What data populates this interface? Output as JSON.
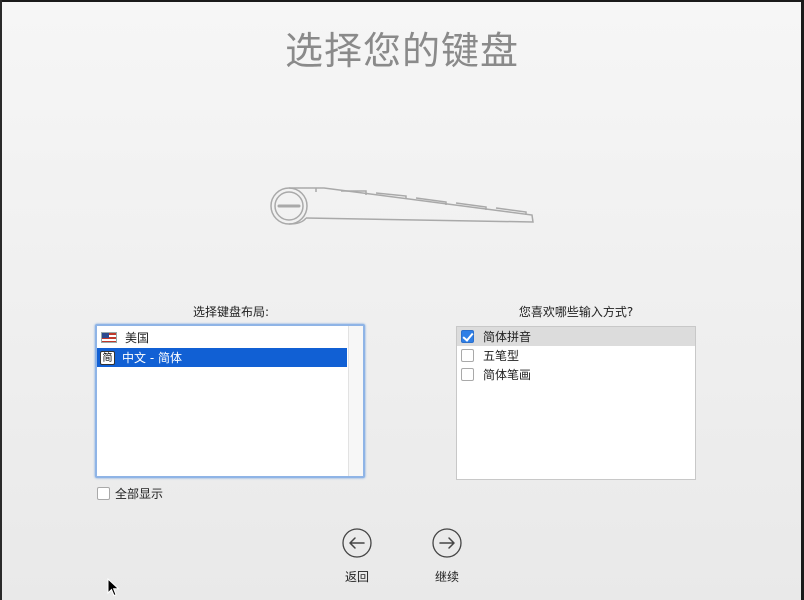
{
  "header": {
    "title": "选择您的键盘"
  },
  "layout_panel": {
    "label": "选择键盘布局:",
    "items": [
      {
        "label": "美国",
        "icon": "us-flag-icon",
        "selected": false
      },
      {
        "label": "中文 - 简体",
        "icon_text": "简",
        "selected": true
      }
    ],
    "show_all_label": "全部显示",
    "show_all_checked": false
  },
  "input_panel": {
    "label": "您喜欢哪些输入方式?",
    "items": [
      {
        "label": "简体拼音",
        "checked": true
      },
      {
        "label": "五笔型",
        "checked": false
      },
      {
        "label": "简体笔画",
        "checked": false
      }
    ]
  },
  "nav": {
    "back_label": "返回",
    "next_label": "继续"
  },
  "colors": {
    "selection": "#1160d4",
    "title": "#8a8a8a",
    "checkbox_checked": "#2f7fe6"
  }
}
